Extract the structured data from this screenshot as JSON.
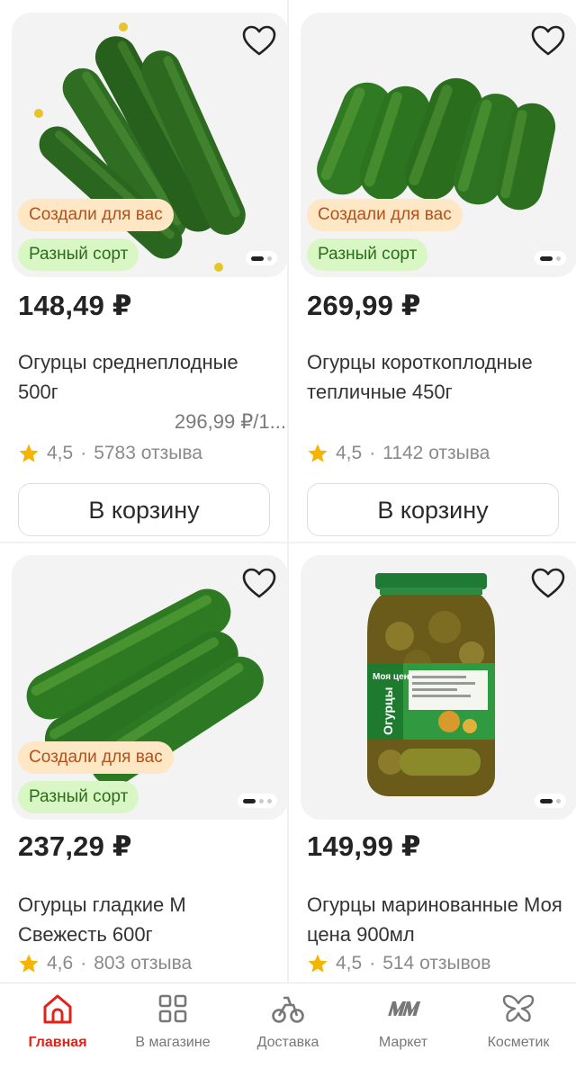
{
  "products": [
    {
      "price": "148,49 ₽",
      "name": "Огурцы среднеплодные 500г",
      "unit_price": "296,99 ₽/1...",
      "rating": "4,5",
      "reviews": "5783 отзыва",
      "badge_made": "Создали для вас",
      "badge_sort": "Разный сорт",
      "cart_label": "В корзину"
    },
    {
      "price": "269,99 ₽",
      "name": "Огурцы короткоплодные тепличные 450г",
      "rating": "4,5",
      "reviews": "1142 отзыва",
      "badge_made": "Создали для вас",
      "badge_sort": "Разный сорт",
      "cart_label": "В корзину"
    },
    {
      "price": "237,29 ₽",
      "name": "Огурцы гладкие М Свежесть 600г",
      "rating": "4,6",
      "reviews": "803 отзыва",
      "badge_made": "Создали для вас",
      "badge_sort": "Разный сорт"
    },
    {
      "price": "149,99 ₽",
      "name": "Огурцы маринованные Моя цена 900мл",
      "rating": "4,5",
      "reviews": "514 отзывов",
      "jar_brand": "Моя цена",
      "jar_title": "Огурцы"
    }
  ],
  "rating_separator": "·",
  "nav": [
    {
      "label": "Главная",
      "icon": "home-icon",
      "active": true
    },
    {
      "label": "В магазине",
      "icon": "grid-icon"
    },
    {
      "label": "Доставка",
      "icon": "delivery-bike-icon"
    },
    {
      "label": "Маркет",
      "icon": "mm-market-logo"
    },
    {
      "label": "Косметик",
      "icon": "butterfly-icon"
    }
  ],
  "colors": {
    "accent": "#e2231a",
    "badge_made_bg": "#fde7c4",
    "badge_made_text": "#b4501b",
    "badge_sort_bg": "#d9f7c4",
    "badge_sort_text": "#2c6b1a",
    "star": "#f5b400"
  }
}
